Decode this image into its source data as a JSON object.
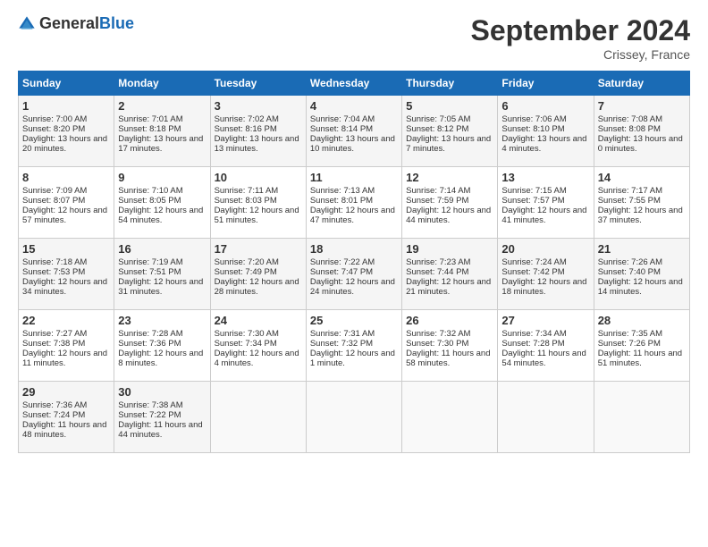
{
  "logo": {
    "general": "General",
    "blue": "Blue"
  },
  "title": "September 2024",
  "location": "Crissey, France",
  "days_of_week": [
    "Sunday",
    "Monday",
    "Tuesday",
    "Wednesday",
    "Thursday",
    "Friday",
    "Saturday"
  ],
  "weeks": [
    [
      {
        "day": "1",
        "sunrise": "Sunrise: 7:00 AM",
        "sunset": "Sunset: 8:20 PM",
        "daylight": "Daylight: 13 hours and 20 minutes."
      },
      {
        "day": "2",
        "sunrise": "Sunrise: 7:01 AM",
        "sunset": "Sunset: 8:18 PM",
        "daylight": "Daylight: 13 hours and 17 minutes."
      },
      {
        "day": "3",
        "sunrise": "Sunrise: 7:02 AM",
        "sunset": "Sunset: 8:16 PM",
        "daylight": "Daylight: 13 hours and 13 minutes."
      },
      {
        "day": "4",
        "sunrise": "Sunrise: 7:04 AM",
        "sunset": "Sunset: 8:14 PM",
        "daylight": "Daylight: 13 hours and 10 minutes."
      },
      {
        "day": "5",
        "sunrise": "Sunrise: 7:05 AM",
        "sunset": "Sunset: 8:12 PM",
        "daylight": "Daylight: 13 hours and 7 minutes."
      },
      {
        "day": "6",
        "sunrise": "Sunrise: 7:06 AM",
        "sunset": "Sunset: 8:10 PM",
        "daylight": "Daylight: 13 hours and 4 minutes."
      },
      {
        "day": "7",
        "sunrise": "Sunrise: 7:08 AM",
        "sunset": "Sunset: 8:08 PM",
        "daylight": "Daylight: 13 hours and 0 minutes."
      }
    ],
    [
      {
        "day": "8",
        "sunrise": "Sunrise: 7:09 AM",
        "sunset": "Sunset: 8:07 PM",
        "daylight": "Daylight: 12 hours and 57 minutes."
      },
      {
        "day": "9",
        "sunrise": "Sunrise: 7:10 AM",
        "sunset": "Sunset: 8:05 PM",
        "daylight": "Daylight: 12 hours and 54 minutes."
      },
      {
        "day": "10",
        "sunrise": "Sunrise: 7:11 AM",
        "sunset": "Sunset: 8:03 PM",
        "daylight": "Daylight: 12 hours and 51 minutes."
      },
      {
        "day": "11",
        "sunrise": "Sunrise: 7:13 AM",
        "sunset": "Sunset: 8:01 PM",
        "daylight": "Daylight: 12 hours and 47 minutes."
      },
      {
        "day": "12",
        "sunrise": "Sunrise: 7:14 AM",
        "sunset": "Sunset: 7:59 PM",
        "daylight": "Daylight: 12 hours and 44 minutes."
      },
      {
        "day": "13",
        "sunrise": "Sunrise: 7:15 AM",
        "sunset": "Sunset: 7:57 PM",
        "daylight": "Daylight: 12 hours and 41 minutes."
      },
      {
        "day": "14",
        "sunrise": "Sunrise: 7:17 AM",
        "sunset": "Sunset: 7:55 PM",
        "daylight": "Daylight: 12 hours and 37 minutes."
      }
    ],
    [
      {
        "day": "15",
        "sunrise": "Sunrise: 7:18 AM",
        "sunset": "Sunset: 7:53 PM",
        "daylight": "Daylight: 12 hours and 34 minutes."
      },
      {
        "day": "16",
        "sunrise": "Sunrise: 7:19 AM",
        "sunset": "Sunset: 7:51 PM",
        "daylight": "Daylight: 12 hours and 31 minutes."
      },
      {
        "day": "17",
        "sunrise": "Sunrise: 7:20 AM",
        "sunset": "Sunset: 7:49 PM",
        "daylight": "Daylight: 12 hours and 28 minutes."
      },
      {
        "day": "18",
        "sunrise": "Sunrise: 7:22 AM",
        "sunset": "Sunset: 7:47 PM",
        "daylight": "Daylight: 12 hours and 24 minutes."
      },
      {
        "day": "19",
        "sunrise": "Sunrise: 7:23 AM",
        "sunset": "Sunset: 7:44 PM",
        "daylight": "Daylight: 12 hours and 21 minutes."
      },
      {
        "day": "20",
        "sunrise": "Sunrise: 7:24 AM",
        "sunset": "Sunset: 7:42 PM",
        "daylight": "Daylight: 12 hours and 18 minutes."
      },
      {
        "day": "21",
        "sunrise": "Sunrise: 7:26 AM",
        "sunset": "Sunset: 7:40 PM",
        "daylight": "Daylight: 12 hours and 14 minutes."
      }
    ],
    [
      {
        "day": "22",
        "sunrise": "Sunrise: 7:27 AM",
        "sunset": "Sunset: 7:38 PM",
        "daylight": "Daylight: 12 hours and 11 minutes."
      },
      {
        "day": "23",
        "sunrise": "Sunrise: 7:28 AM",
        "sunset": "Sunset: 7:36 PM",
        "daylight": "Daylight: 12 hours and 8 minutes."
      },
      {
        "day": "24",
        "sunrise": "Sunrise: 7:30 AM",
        "sunset": "Sunset: 7:34 PM",
        "daylight": "Daylight: 12 hours and 4 minutes."
      },
      {
        "day": "25",
        "sunrise": "Sunrise: 7:31 AM",
        "sunset": "Sunset: 7:32 PM",
        "daylight": "Daylight: 12 hours and 1 minute."
      },
      {
        "day": "26",
        "sunrise": "Sunrise: 7:32 AM",
        "sunset": "Sunset: 7:30 PM",
        "daylight": "Daylight: 11 hours and 58 minutes."
      },
      {
        "day": "27",
        "sunrise": "Sunrise: 7:34 AM",
        "sunset": "Sunset: 7:28 PM",
        "daylight": "Daylight: 11 hours and 54 minutes."
      },
      {
        "day": "28",
        "sunrise": "Sunrise: 7:35 AM",
        "sunset": "Sunset: 7:26 PM",
        "daylight": "Daylight: 11 hours and 51 minutes."
      }
    ],
    [
      {
        "day": "29",
        "sunrise": "Sunrise: 7:36 AM",
        "sunset": "Sunset: 7:24 PM",
        "daylight": "Daylight: 11 hours and 48 minutes."
      },
      {
        "day": "30",
        "sunrise": "Sunrise: 7:38 AM",
        "sunset": "Sunset: 7:22 PM",
        "daylight": "Daylight: 11 hours and 44 minutes."
      },
      {
        "day": "",
        "sunrise": "",
        "sunset": "",
        "daylight": ""
      },
      {
        "day": "",
        "sunrise": "",
        "sunset": "",
        "daylight": ""
      },
      {
        "day": "",
        "sunrise": "",
        "sunset": "",
        "daylight": ""
      },
      {
        "day": "",
        "sunrise": "",
        "sunset": "",
        "daylight": ""
      },
      {
        "day": "",
        "sunrise": "",
        "sunset": "",
        "daylight": ""
      }
    ]
  ]
}
